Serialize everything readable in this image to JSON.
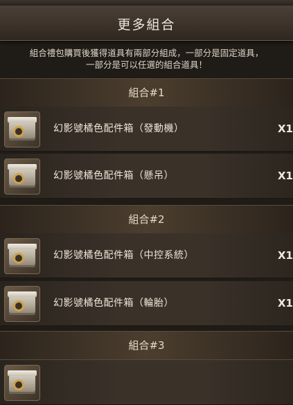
{
  "header": {
    "title": "更多組合"
  },
  "description": {
    "line1": "組合禮包購買後獲得道具有兩部分組成，一部分是固定道具，",
    "line2": "一部分是可以任選的組合道具！"
  },
  "groups": [
    {
      "label": "組合#1",
      "items": [
        {
          "name": "幻影號橘色配件箱（發動機）",
          "qty": "X1",
          "icon": "parts-crate-icon"
        },
        {
          "name": "幻影號橘色配件箱（懸吊）",
          "qty": "X1",
          "icon": "parts-crate-icon"
        }
      ]
    },
    {
      "label": "組合#2",
      "items": [
        {
          "name": "幻影號橘色配件箱（中控系統）",
          "qty": "X1",
          "icon": "parts-crate-icon"
        },
        {
          "name": "幻影號橘色配件箱（輪胎）",
          "qty": "X1",
          "icon": "parts-crate-icon"
        }
      ]
    },
    {
      "label": "組合#3",
      "items": []
    }
  ]
}
